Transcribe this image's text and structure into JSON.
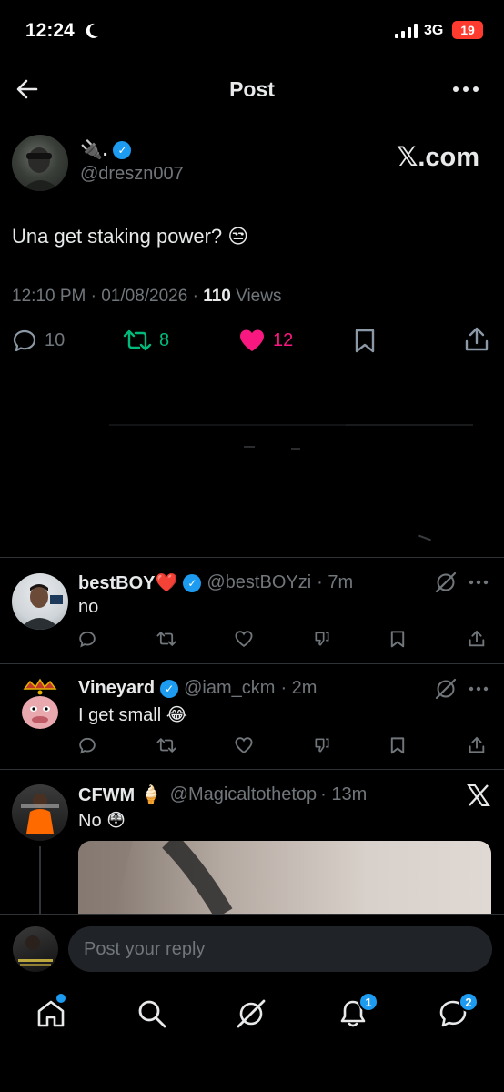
{
  "status_bar": {
    "time": "12:24",
    "network": "3G",
    "battery": "19"
  },
  "header": {
    "title": "Post"
  },
  "post": {
    "author_name": "🔌.",
    "author_handle": "@dreszn007",
    "watermark": "𝕏.com",
    "text": "Una get staking power? 😒",
    "timestamp": "12:10 PM · 01/08/2026 · ",
    "views_count": "110",
    "views_label": " Views",
    "replies": "10",
    "reposts": "8",
    "likes": "12"
  },
  "replies": [
    {
      "name": "bestBOY❤️",
      "handle": "@bestBOYzi",
      "time": "· 7m",
      "text": "no"
    },
    {
      "name": "Vineyard",
      "handle": "@iam_ckm",
      "time": "· 2m",
      "text": "I get small 😂"
    },
    {
      "name": "CFWM 🍦",
      "handle": "@Magicaltothetop",
      "time": "· 13m",
      "text": "No 😳"
    }
  ],
  "compose": {
    "placeholder": "Post your reply"
  },
  "bottom_nav": {
    "notifications_badge": "1",
    "messages_badge": "2"
  },
  "colors": {
    "accent": "#1d9bf0",
    "like": "#f91880",
    "repost": "#00ba7c",
    "muted": "#71767b"
  }
}
